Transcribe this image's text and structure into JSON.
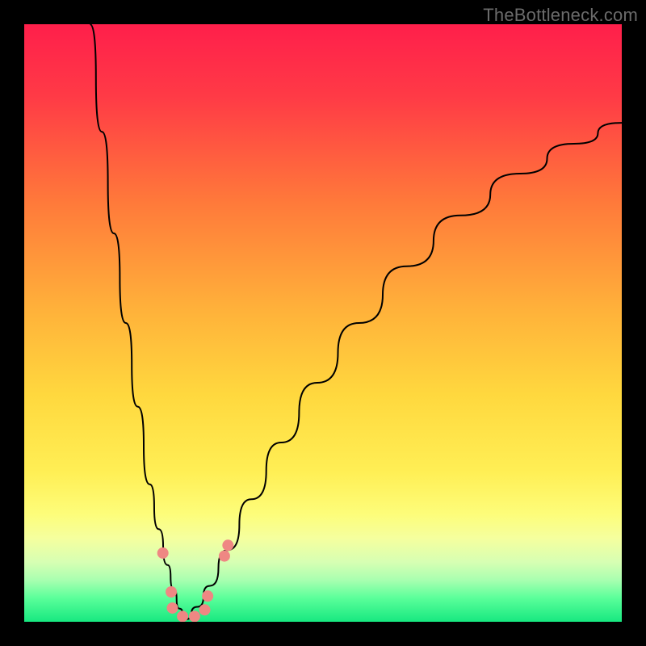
{
  "watermark": "TheBottleneck.com",
  "colors": {
    "frame": "#000000",
    "watermark": "#6b6b6b",
    "curve": "#000000",
    "dot": "#ef8783",
    "gradient_stops": [
      {
        "pct": 0,
        "color": "#ff1f4b"
      },
      {
        "pct": 12,
        "color": "#ff3a46"
      },
      {
        "pct": 30,
        "color": "#ff7a3a"
      },
      {
        "pct": 48,
        "color": "#ffb23a"
      },
      {
        "pct": 62,
        "color": "#ffd83e"
      },
      {
        "pct": 75,
        "color": "#ffef55"
      },
      {
        "pct": 82,
        "color": "#fdfd7a"
      },
      {
        "pct": 86,
        "color": "#f5ff9e"
      },
      {
        "pct": 90,
        "color": "#d7ffb3"
      },
      {
        "pct": 93,
        "color": "#a9ffb0"
      },
      {
        "pct": 96,
        "color": "#5bff9a"
      },
      {
        "pct": 100,
        "color": "#17e880"
      }
    ]
  },
  "chart_data": {
    "type": "line",
    "title": "",
    "xlabel": "",
    "ylabel": "",
    "xlim": [
      0,
      100
    ],
    "ylim": [
      0,
      100
    ],
    "grid": false,
    "gradient_axis": "y",
    "optimum_x": 27,
    "series": [
      {
        "name": "left-branch",
        "x": [
          11.0,
          13.0,
          15.0,
          17.0,
          19.0,
          21.0,
          22.5,
          24.0,
          25.0,
          26.0,
          27.0
        ],
        "y": [
          100.0,
          82.0,
          65.0,
          50.0,
          36.0,
          23.0,
          15.5,
          9.5,
          5.5,
          2.2,
          0.4
        ]
      },
      {
        "name": "right-branch",
        "x": [
          27.0,
          29.0,
          31.0,
          34.0,
          38.0,
          43.0,
          49.0,
          56.0,
          64.0,
          73.0,
          83.0,
          92.0,
          100.0
        ],
        "y": [
          0.4,
          2.5,
          6.0,
          12.0,
          20.5,
          30.0,
          40.0,
          50.0,
          59.5,
          68.0,
          75.0,
          80.0,
          83.5
        ]
      }
    ],
    "scatter": {
      "name": "near-optimum-points",
      "points": [
        {
          "x": 23.2,
          "y": 11.5
        },
        {
          "x": 24.6,
          "y": 5.0
        },
        {
          "x": 24.8,
          "y": 2.3
        },
        {
          "x": 26.5,
          "y": 0.9
        },
        {
          "x": 28.5,
          "y": 0.9
        },
        {
          "x": 30.2,
          "y": 2.0
        },
        {
          "x": 30.7,
          "y": 4.3
        },
        {
          "x": 33.5,
          "y": 11.0
        },
        {
          "x": 34.1,
          "y": 12.8
        }
      ]
    }
  }
}
